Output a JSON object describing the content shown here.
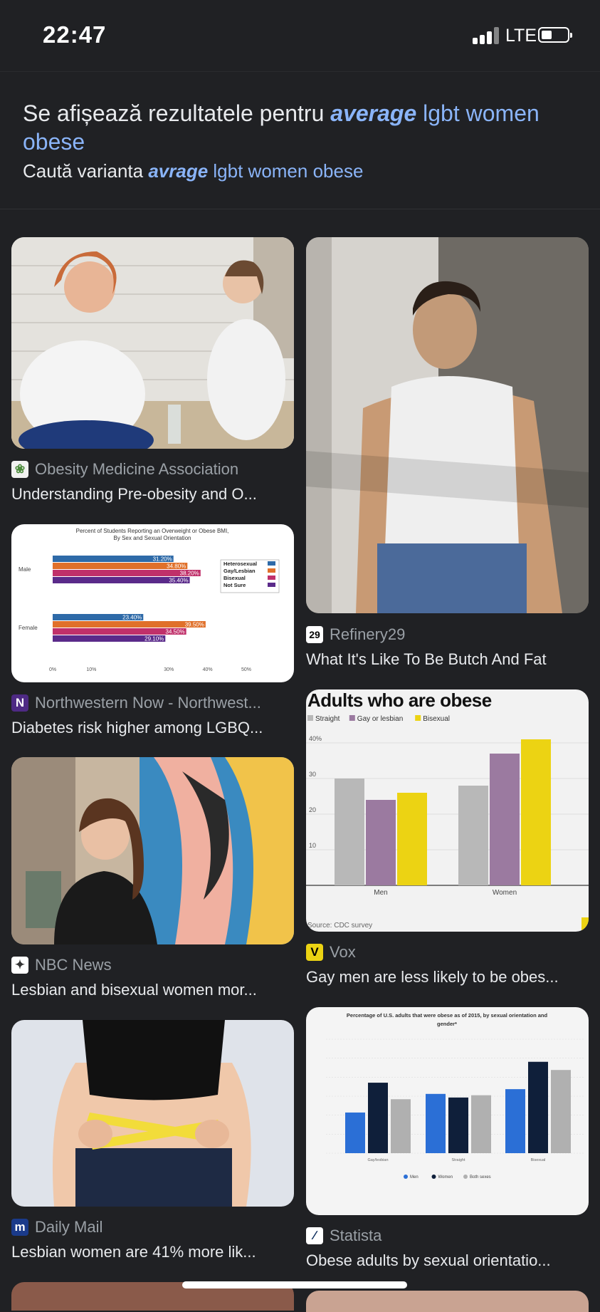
{
  "status_bar": {
    "time": "22:47",
    "network": "LTE"
  },
  "notice": {
    "prefix": "Se afișează rezultatele pentru ",
    "corrected_bold": "average",
    "corrected_rest": " lgbt women obese",
    "instead_prefix": "Caută varianta ",
    "instead_bold": "avrage",
    "instead_rest": " lgbt women obese"
  },
  "results": [
    {
      "source": "Obesity Medicine Association",
      "title": "Understanding Pre-obesity and O...",
      "favicon": "leaf-icon",
      "favicon_glyph": "❀"
    },
    {
      "source": "Refinery29",
      "title": "What It's Like To Be Butch And Fat",
      "favicon": "refinery-icon",
      "favicon_glyph": "29"
    },
    {
      "source": "Northwestern Now - Northwest...",
      "title": "Diabetes risk higher among LGBQ...",
      "favicon": "northwestern-icon",
      "favicon_glyph": "N"
    },
    {
      "source": "Vox",
      "title": "Gay men are less likely to be obes...",
      "favicon": "vox-icon",
      "favicon_glyph": "V"
    },
    {
      "source": "NBC News",
      "title": "Lesbian and bisexual women mor...",
      "favicon": "peacock-icon",
      "favicon_glyph": "✦"
    },
    {
      "source": "Statista",
      "title": "Obese adults by sexual orientatio...",
      "favicon": "statista-icon",
      "favicon_glyph": "∕"
    },
    {
      "source": "Daily Mail",
      "title": "Lesbian women are 41% more lik...",
      "favicon": "dailymail-icon",
      "favicon_glyph": "m"
    }
  ],
  "chart_northwestern": {
    "title_line1": "Percent of Students Reporting an Overweight or Obese BMI,",
    "title_line2": "By Sex and Sexual Orientation",
    "groups": [
      "Male",
      "Female"
    ],
    "legend": [
      "Heterosexual",
      "Gay/Lesbian",
      "Bisexual",
      "Not Sure"
    ],
    "colors": [
      "#2e6aa8",
      "#e0702a",
      "#c0306a",
      "#5a2a8a"
    ],
    "values": [
      [
        31.2,
        34.8,
        38.2,
        35.4
      ],
      [
        23.4,
        39.5,
        34.5,
        29.1
      ]
    ],
    "labels": [
      [
        "31.20%",
        "34.80%",
        "38.20%",
        "35.40%"
      ],
      [
        "23.40%",
        "39.50%",
        "34.50%",
        "29.10%"
      ]
    ],
    "ticks": [
      "0%",
      "10%",
      "",
      "30%",
      "40%",
      "50%"
    ],
    "xmax": 50
  },
  "chart_vox": {
    "title": "Adults who are obese",
    "legend": [
      "Straight",
      "Gay or lesbian",
      "Bisexual"
    ],
    "colors": [
      "#b8b8b8",
      "#9b7aa0",
      "#ecd313"
    ],
    "categories": [
      "Men",
      "Women"
    ],
    "values": [
      [
        30,
        24,
        26
      ],
      [
        28,
        37,
        41
      ]
    ],
    "ticks": [
      "40%",
      "30",
      "20",
      "10"
    ],
    "ymax": 43,
    "source": "Source: CDC survey"
  },
  "chart_statista": {
    "title_line1": "Percentage of U.S. adults that were obese as of 2015, by sexual orientation and",
    "title_line2": "gender*",
    "legend": [
      "Men",
      "Women",
      "Both sexes"
    ],
    "colors": [
      "#2b6fd6",
      "#0f1f3a",
      "#b0b0b0"
    ],
    "categories": [
      "Gay/lesbian",
      "Straight",
      "Bisexual"
    ],
    "values": [
      [
        21.4,
        37.1,
        28.4
      ],
      [
        31.2,
        29.3,
        30.5
      ],
      [
        33.7,
        48.1,
        43.8
      ]
    ],
    "ymax": 60
  },
  "colors": {
    "background": "#202124",
    "link": "#8ab4f8",
    "text": "#e8eaed",
    "muted": "#9aa0a6"
  }
}
